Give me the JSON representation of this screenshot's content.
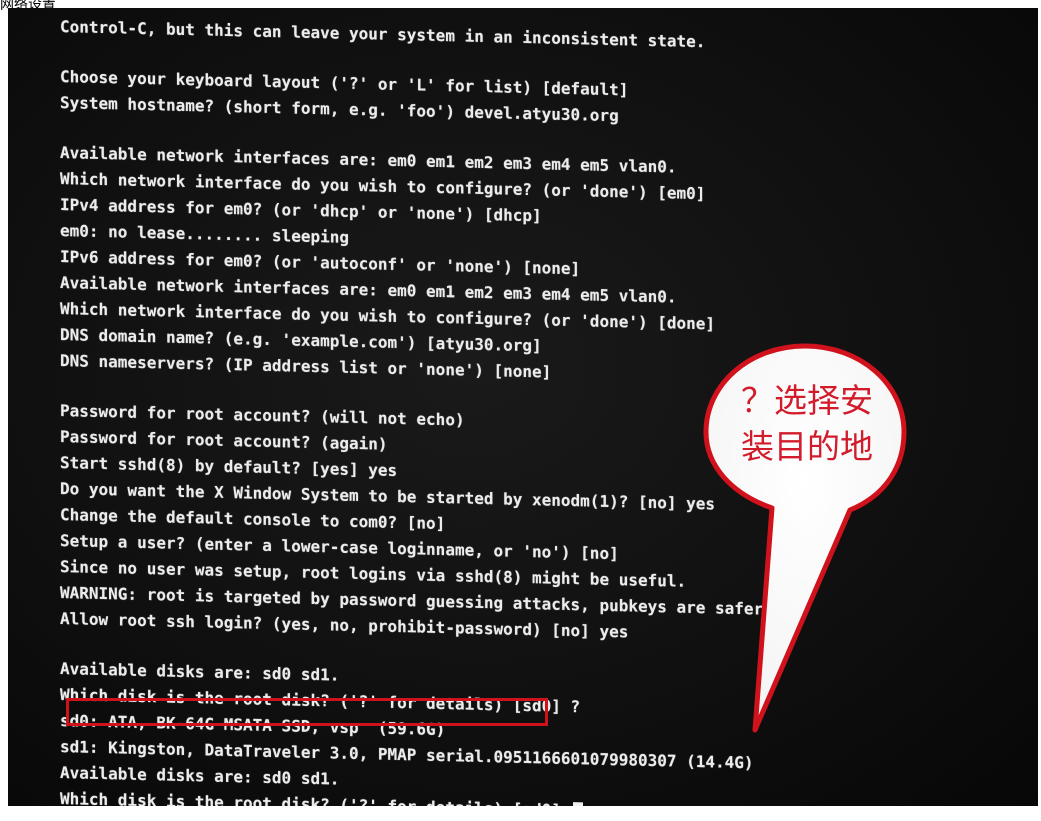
{
  "top_crop_text": "网络设置",
  "console": {
    "lines": [
      "Control-C, but this can leave your system in an inconsistent state.",
      "",
      "Choose your keyboard layout ('?' or 'L' for list) [default]",
      "System hostname? (short form, e.g. 'foo') devel.atyu30.org",
      "",
      "Available network interfaces are: em0 em1 em2 em3 em4 em5 vlan0.",
      "Which network interface do you wish to configure? (or 'done') [em0]",
      "IPv4 address for em0? (or 'dhcp' or 'none') [dhcp]",
      "em0: no lease........ sleeping",
      "IPv6 address for em0? (or 'autoconf' or 'none') [none]",
      "Available network interfaces are: em0 em1 em2 em3 em4 em5 vlan0.",
      "Which network interface do you wish to configure? (or 'done') [done]",
      "DNS domain name? (e.g. 'example.com') [atyu30.org]",
      "DNS nameservers? (IP address list or 'none') [none]",
      "",
      "Password for root account? (will not echo)",
      "Password for root account? (again)",
      "Start sshd(8) by default? [yes] yes",
      "Do you want the X Window System to be started by xenodm(1)? [no] yes",
      "Change the default console to com0? [no]",
      "Setup a user? (enter a lower-case loginname, or 'no') [no]",
      "Since no user was setup, root logins via sshd(8) might be useful.",
      "WARNING: root is targeted by password guessing attacks, pubkeys are safer.",
      "Allow root ssh login? (yes, no, prohibit-password) [no] yes",
      "",
      "Available disks are: sd0 sd1.",
      "Which disk is the root disk? ('?' for details) [sd0] ?",
      "sd0: ATA, BK-64G MSATA SSD, vsp  (59.6G)",
      "sd1: Kingston, DataTraveler 3.0, PMAP serial.0951166601079980307 (14.4G)",
      "Available disks are: sd0 sd1.",
      "Which disk is the root disk? ('?' for details) [sd0] "
    ]
  },
  "callout": {
    "line1": "？选择安",
    "line2": "装目的地"
  },
  "colors": {
    "console_text": "#ececec",
    "background": "#101010",
    "highlight": "#d0121c",
    "callout_text": "#d21c2c"
  }
}
